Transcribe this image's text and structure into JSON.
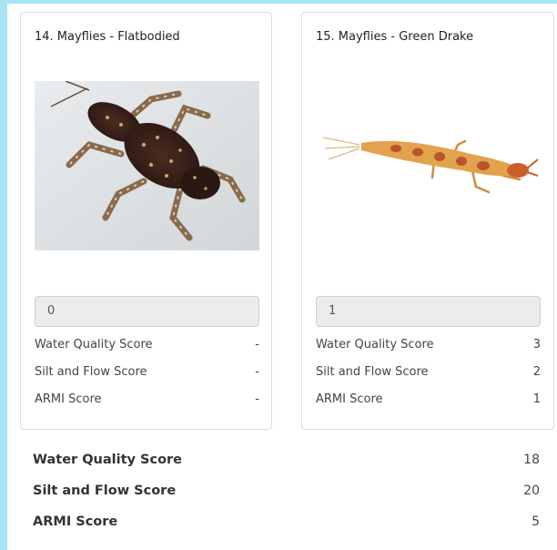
{
  "cards": [
    {
      "title": "14. Mayflies - Flatbodied",
      "image_alt": "flatbodied mayfly nymph",
      "count_value": "0",
      "scores": [
        {
          "label": "Water Quality Score",
          "value": "-"
        },
        {
          "label": "Silt and Flow Score",
          "value": "-"
        },
        {
          "label": "ARMI Score",
          "value": "-"
        }
      ]
    },
    {
      "title": "15. Mayflies - Green Drake",
      "image_alt": "green drake mayfly nymph",
      "count_value": "1",
      "scores": [
        {
          "label": "Water Quality Score",
          "value": "3"
        },
        {
          "label": "Silt and Flow Score",
          "value": "2"
        },
        {
          "label": "ARMI Score",
          "value": "1"
        }
      ]
    }
  ],
  "totals": [
    {
      "label": "Water Quality Score",
      "value": "18"
    },
    {
      "label": "Silt and Flow Score",
      "value": "20"
    },
    {
      "label": "ARMI Score",
      "value": "5"
    }
  ],
  "colors": {
    "accent_stripe": "#a9e4f6",
    "card_border": "#dcdcdc",
    "input_background": "#ececec"
  }
}
